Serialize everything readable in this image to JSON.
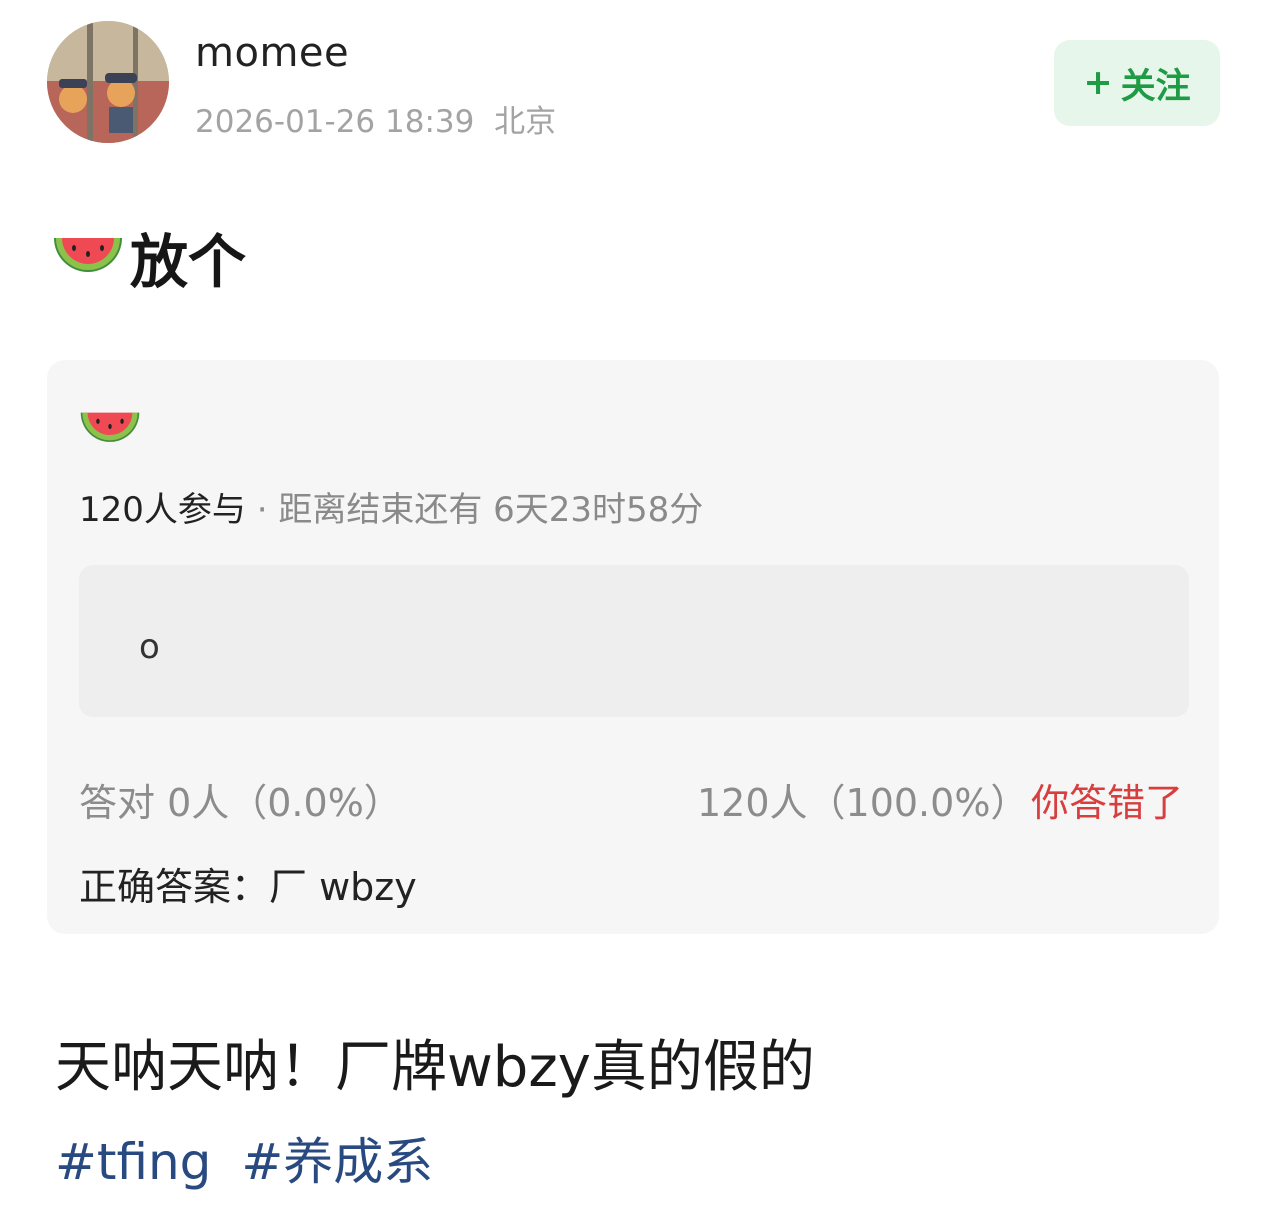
{
  "post": {
    "username": "momee",
    "timestamp": "2026-01-26 18:39",
    "location": "北京",
    "follow_label": "关注",
    "title_emoji": "watermelon-icon",
    "title_text": "放个",
    "body": "天呐天呐！厂牌wbzy真的假的",
    "tags": [
      "#tfing",
      "#养成系"
    ]
  },
  "quiz": {
    "emoji": "watermelon-icon",
    "participants": "120人参与",
    "separator": "·",
    "remaining": "距离结束还有 6天23时58分",
    "selected_answer": "o",
    "correct_stat": "答对  0人（0.0%）",
    "wrong_stat": "120人（100.0%）",
    "wrong_verdict": "你答错了",
    "correct_answer": "正确答案：厂 wbzy"
  },
  "colors": {
    "follow_bg": "#e7f6ea",
    "follow_text": "#1f9b45",
    "wrong": "#d73f3f",
    "tag": "#284a80"
  }
}
